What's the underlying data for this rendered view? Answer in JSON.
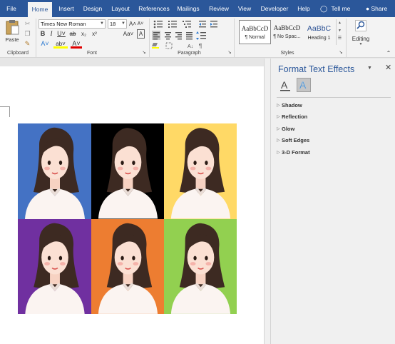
{
  "tabs": [
    {
      "label": "File",
      "active": false
    },
    {
      "label": "Home",
      "active": true
    },
    {
      "label": "Insert",
      "active": false
    },
    {
      "label": "Design",
      "active": false
    },
    {
      "label": "Layout",
      "active": false
    },
    {
      "label": "References",
      "active": false
    },
    {
      "label": "Mailings",
      "active": false
    },
    {
      "label": "Review",
      "active": false
    },
    {
      "label": "View",
      "active": false
    },
    {
      "label": "Developer",
      "active": false
    },
    {
      "label": "Help",
      "active": false
    }
  ],
  "tell_me": "Tell me",
  "share": "Share",
  "clipboard": {
    "paste_label": "Paste",
    "group_label": "Clipboard"
  },
  "font": {
    "name": "Times New Roman",
    "size": "18",
    "group_label": "Font",
    "row1": [
      "A˄",
      "A˅",
      "Aa˅",
      "A"
    ],
    "row2": [
      "B",
      "I",
      "U˅",
      "ab",
      "x₂",
      "x²"
    ],
    "row3": [
      "A˅",
      "ab˅",
      "A˅"
    ]
  },
  "paragraph": {
    "group_label": "Paragraph"
  },
  "styles": {
    "group_label": "Styles",
    "items": [
      {
        "sample": "AaBbCcD",
        "name": "¶ Normal"
      },
      {
        "sample": "AaBbCcD",
        "name": "¶ No Spac..."
      },
      {
        "sample": "AaBbC",
        "name": "Heading 1"
      }
    ]
  },
  "editing": {
    "label": "Editing"
  },
  "pane": {
    "title": "Format Text Effects",
    "sections": [
      "Shadow",
      "Reflection",
      "Glow",
      "Soft Edges",
      "3-D Format"
    ]
  },
  "colors": {
    "accent": "#2b579a",
    "cell_backgrounds": [
      "#4472c4",
      "#000000",
      "#ffd966",
      "#7030a0",
      "#ed7d31",
      "#92d050"
    ]
  }
}
